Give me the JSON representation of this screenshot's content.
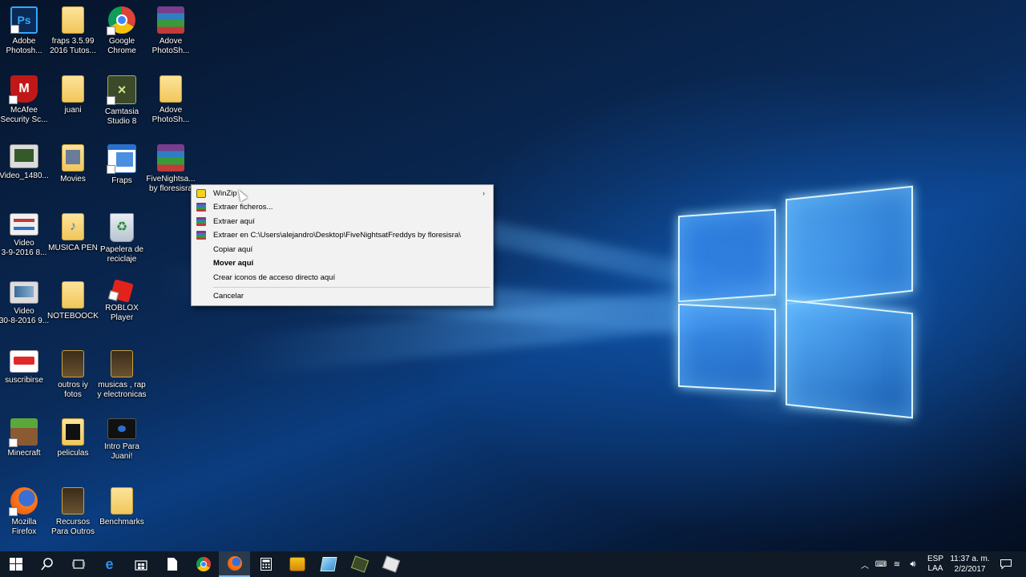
{
  "desktop_icons": [
    {
      "label": "Adobe\nPhotosh...",
      "icon": "photoshop-icon"
    },
    {
      "label": "fraps 3.5.99\n2016 Tutos...",
      "icon": "folder-icon"
    },
    {
      "label": "Google\nChrome",
      "icon": "chrome-icon"
    },
    {
      "label": "Adove\nPhotoSh...",
      "icon": "winrar-archive-icon"
    },
    {
      "label": "McAfee\nSecurity Sc...",
      "icon": "mcafee-icon"
    },
    {
      "label": "juani",
      "icon": "folder-icon"
    },
    {
      "label": "Camtasia\nStudio 8",
      "icon": "camtasia-icon"
    },
    {
      "label": "Adove\nPhotoSh...",
      "icon": "folder-icon"
    },
    {
      "label": "Video_1480...",
      "icon": "video-file-icon"
    },
    {
      "label": "Movies",
      "icon": "folder-icon"
    },
    {
      "label": "Fraps",
      "icon": "fraps-icon"
    },
    {
      "label": "FiveNightsa...\nby floresisra",
      "icon": "winrar-archive-icon"
    },
    {
      "label": "Video\n3-9-2016 8...",
      "icon": "video-file-icon"
    },
    {
      "label": "MUSICA PEN",
      "icon": "folder-icon"
    },
    {
      "label": "Papelera de\nreciclaje",
      "icon": "recycle-bin-icon"
    },
    {
      "label": "Video\n30-8-2016 9...",
      "icon": "video-file-icon"
    },
    {
      "label": "NOTEBOOCK",
      "icon": "folder-icon"
    },
    {
      "label": "ROBLOX\nPlayer",
      "icon": "roblox-icon"
    },
    {
      "label": "suscribirse",
      "icon": "subscribe-image-icon"
    },
    {
      "label": "outros iy\nfotos",
      "icon": "folder-icon"
    },
    {
      "label": "musicas , rap\ny electronicas",
      "icon": "folder-icon"
    },
    {
      "label": "Minecraft",
      "icon": "minecraft-icon"
    },
    {
      "label": "peliculas",
      "icon": "folder-icon"
    },
    {
      "label": "Intro Para\nJuani!",
      "icon": "video-file-icon"
    },
    {
      "label": "Mozilla\nFirefox",
      "icon": "firefox-icon"
    },
    {
      "label": "Recursos\nPara Outros",
      "icon": "folder-icon"
    },
    {
      "label": "Benchmarks",
      "icon": "folder-icon"
    }
  ],
  "context_menu": {
    "items": [
      {
        "label": "WinZip",
        "icon": "winzip-icon",
        "has_submenu": true
      },
      {
        "label": "Extraer ficheros...",
        "icon": "winrar-icon"
      },
      {
        "label": "Extraer aquí",
        "icon": "winrar-icon"
      },
      {
        "label": "Extraer en C:\\Users\\alejandro\\Desktop\\FiveNightsatFreddys by floresisra\\",
        "icon": "winrar-icon"
      },
      {
        "label": "Copiar aquí",
        "icon": ""
      },
      {
        "label": "Mover aquí",
        "icon": "",
        "bold": true
      },
      {
        "label": "Crear iconos de acceso directo aquí",
        "icon": ""
      },
      {
        "label": "Cancelar",
        "icon": ""
      }
    ],
    "submenu_arrow": "›"
  },
  "taskbar": {
    "buttons": [
      "start-icon",
      "search-icon",
      "task-view-icon",
      "edge-icon",
      "store-icon",
      "file-icon",
      "chrome-icon",
      "firefox-icon",
      "calculator-icon",
      "gamepad-icon",
      "notepad-icon",
      "camtasia-icon",
      "video-editor-icon"
    ],
    "active_button": "firefox-icon",
    "tray": {
      "language": "ESP",
      "layout": "LAA",
      "time": "11:37 a. m.",
      "date": "2/2/2017"
    }
  }
}
